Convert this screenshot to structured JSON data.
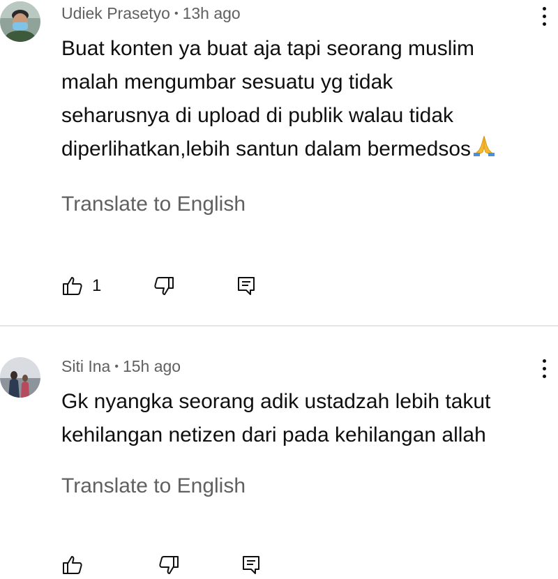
{
  "comments": [
    {
      "author": "Udiek Prasetyo",
      "time": "13h ago",
      "lines": [
        "Buat konten ya buat aja tapi seorang muslim",
        "malah mengumbar sesuatu yg tidak",
        "seharusnya di upload di publik walau tidak",
        "diperlihatkan,lebih santun dalam bermedsos"
      ],
      "emoji": "folded-hands",
      "translate_label": "Translate to English",
      "like_count": "1"
    },
    {
      "author": "Siti Ina",
      "time": "15h ago",
      "lines": [
        "Gk nyangka seorang adik ustadzah  lebih takut",
        "kehilangan netizen dari pada kehilangan allah"
      ],
      "translate_label": "Translate to English"
    }
  ],
  "separator": "•",
  "icons": {
    "like": "thumbs-up-icon",
    "dislike": "thumbs-down-icon",
    "reply": "reply-icon",
    "more": "more-vertical-icon"
  },
  "colors": {
    "text": "#0f0f0f",
    "secondary": "#606060",
    "divider": "#e5e5e5"
  }
}
